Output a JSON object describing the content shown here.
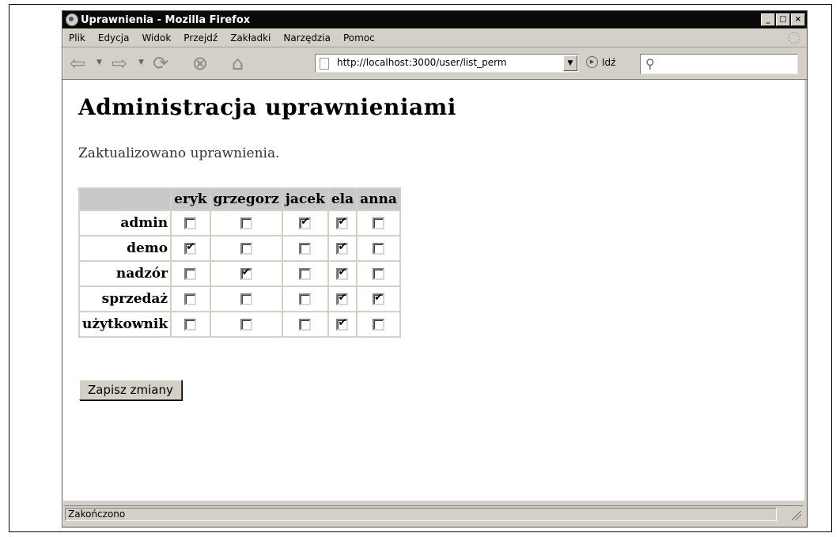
{
  "window": {
    "title": "Uprawnienia - Mozilla Firefox",
    "controls": [
      "_",
      "□",
      "×"
    ]
  },
  "menu": [
    {
      "label": "Plik"
    },
    {
      "label": "Edycja"
    },
    {
      "label": "Widok"
    },
    {
      "label": "Przejdź"
    },
    {
      "label": "Zakładki"
    },
    {
      "label": "Narzędzia"
    },
    {
      "label": "Pomoc"
    }
  ],
  "toolbar": {
    "url": "http://localhost:3000/user/list_perm",
    "go_label": "Idź",
    "search_value": ""
  },
  "page": {
    "heading": "Administracja uprawnieniami",
    "message": "Zaktualizowano uprawnienia.",
    "users": [
      "eryk",
      "grzegorz",
      "jacek",
      "ela",
      "anna"
    ],
    "roles": [
      {
        "name": "admin",
        "checks": [
          false,
          false,
          true,
          true,
          false
        ]
      },
      {
        "name": "demo",
        "checks": [
          true,
          false,
          false,
          true,
          false
        ]
      },
      {
        "name": "nadzór",
        "checks": [
          false,
          true,
          false,
          true,
          false
        ]
      },
      {
        "name": "sprzedaż",
        "checks": [
          false,
          false,
          false,
          true,
          true
        ]
      },
      {
        "name": "użytkownik",
        "checks": [
          false,
          false,
          false,
          true,
          false
        ]
      }
    ],
    "save_label": "Zapisz zmiany"
  },
  "status": {
    "text": "Zakończono"
  }
}
